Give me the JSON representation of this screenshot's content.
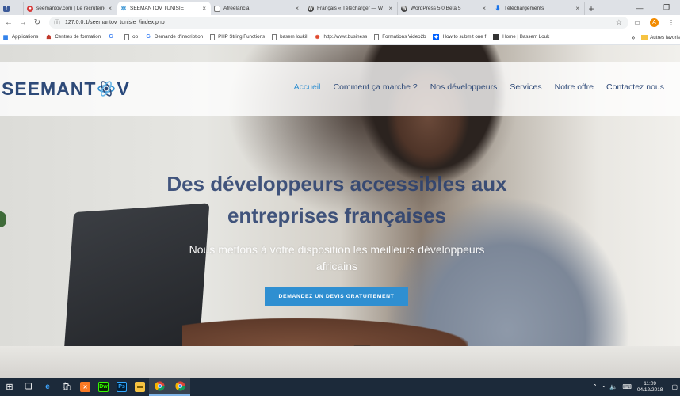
{
  "browser": {
    "tabs": [
      {
        "label": "",
        "favicon": "facebook-icon",
        "active": false
      },
      {
        "label": "seemantov.com | Le recrutement",
        "favicon": "seemantov-icon",
        "active": false
      },
      {
        "label": "SEEMANTOV TUNISIE",
        "favicon": "seemantov-atom-icon",
        "active": true
      },
      {
        "label": "Afreelancia",
        "favicon": "page-icon",
        "active": false
      },
      {
        "label": "Français « Télécharger — W",
        "favicon": "wordpress-icon",
        "active": false
      },
      {
        "label": "WordPress 5.0 Beta 5",
        "favicon": "wordpress-icon",
        "active": false
      },
      {
        "label": "Téléchargements",
        "favicon": "download-icon",
        "active": false
      }
    ],
    "url": "127.0.0.1/seemantov_tunisie_/index.php",
    "profile_initial": "A",
    "bookmarks": [
      {
        "label": "Applications",
        "icon": "apps-grid-icon"
      },
      {
        "label": "Centres de formation",
        "icon": "person-icon"
      },
      {
        "label": "",
        "icon": "google-icon"
      },
      {
        "label": "op",
        "icon": "page-icon"
      },
      {
        "label": "Demande d'inscription",
        "icon": "google-icon"
      },
      {
        "label": "PHP String Functions",
        "icon": "page-icon"
      },
      {
        "label": "basem loukil",
        "icon": "page-icon"
      },
      {
        "label": "http://www.business",
        "icon": "settings-icon"
      },
      {
        "label": "Formations Video2b",
        "icon": "page-icon"
      },
      {
        "label": "How to submit one f",
        "icon": "dropbox-icon"
      },
      {
        "label": "Home | Bassem Louk",
        "icon": "page-icon"
      }
    ],
    "bookmarks_overflow": "»",
    "other_bookmarks": "Autres favoris"
  },
  "site": {
    "logo_text_left": "SEEMANT",
    "logo_text_right": "V",
    "menu": [
      {
        "label": "Accueil",
        "active": true
      },
      {
        "label": "Comment ça marche ?",
        "active": false
      },
      {
        "label": "Nos développeurs",
        "active": false
      },
      {
        "label": "Services",
        "active": false
      },
      {
        "label": "Notre offre",
        "active": false
      },
      {
        "label": "Contactez nous",
        "active": false
      }
    ],
    "hero": {
      "title_line1": "Des développeurs accessibles aux",
      "title_line2": "entreprises françaises",
      "subtitle_line1": "Nous mettons à votre disposition les meilleurs développeurs",
      "subtitle_line2": "africains",
      "cta": "DEMANDEZ UN DEVIS GRATUITEMENT"
    }
  },
  "taskbar": {
    "apps": [
      "windows-start-icon",
      "task-view-icon",
      "edge-icon",
      "store-icon",
      "xampp-icon",
      "dreamweaver-icon",
      "photoshop-icon",
      "file-explorer-icon",
      "chrome-icon",
      "chrome-icon"
    ],
    "time": "11:09",
    "date": "04/12/2018"
  },
  "colors": {
    "brand_blue": "#2e4a78",
    "accent": "#2f8fd1",
    "taskbar": "#1c2a3a"
  }
}
